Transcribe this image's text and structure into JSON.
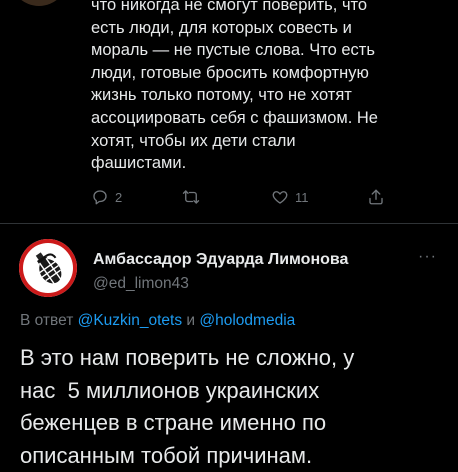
{
  "tweet1": {
    "text_lines": [
      "что никогда не смогут поверить, что",
      "есть люди, для которых совесть и",
      "мораль — не пустые слова. Что есть",
      "люди, готовые бросить комфортную",
      "жизнь только потому, что не хотят",
      "ассоциировать себя с фашизмом. Не",
      "хотят, чтобы их дети стали",
      "фашистами."
    ],
    "replies_count": "2",
    "likes_count": "11"
  },
  "tweet2": {
    "display_name": "Амбассадор Эдуарда Лимонова",
    "handle": "@ed_limon43",
    "more": "···",
    "replying_prefix": "В ответ",
    "mention1": "@Kuzkin_otets",
    "and_word": "и",
    "mention2": "@holodmedia",
    "text_lines": [
      "В это нам поверить не сложно, у",
      "нас  5 миллионов украинских",
      "беженцев в стране именно по",
      "описанным тобой причинам."
    ]
  },
  "colors": {
    "background": "#000000",
    "text": "#e7e9ea",
    "secondary": "#71767b",
    "link": "#1d9bf0",
    "divider": "#2f3336",
    "avatar_ring": "#cc1a1a"
  },
  "icons": [
    "reply-icon",
    "retweet-icon",
    "like-icon",
    "share-icon",
    "grenade-icon"
  ]
}
